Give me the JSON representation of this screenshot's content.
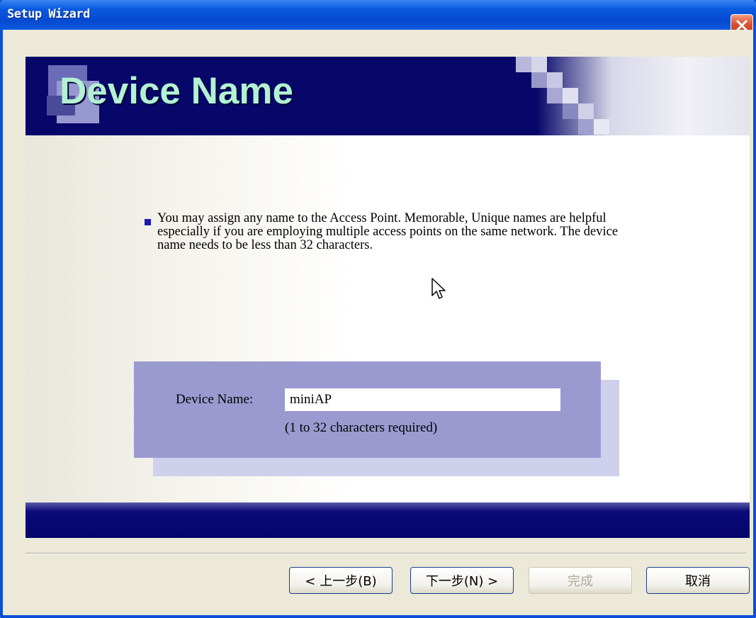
{
  "window": {
    "title": "Setup Wizard"
  },
  "banner": {
    "title": "Device Name"
  },
  "description": "You may assign any name to the Access Point. Memorable, Unique names are helpful especially if you are employing multiple access points on the same network. The device name needs to be less than 32 characters.",
  "form": {
    "device_name_label": "Device Name:",
    "device_name_value": "miniAP",
    "hint": "(1 to 32 characters required)"
  },
  "buttons": {
    "back": "< 上一步(B)",
    "next": "下一步(N) >",
    "finish": "完成",
    "cancel": "取消"
  },
  "colors": {
    "titlebar": "#0a5ae0",
    "banner": "#07076a",
    "banner_title": "#b2f2d2",
    "panel": "#9a9ad0"
  },
  "icons": {
    "close": "close-icon",
    "bullet": "square-bullet-icon",
    "cursor": "mouse-pointer-icon"
  }
}
